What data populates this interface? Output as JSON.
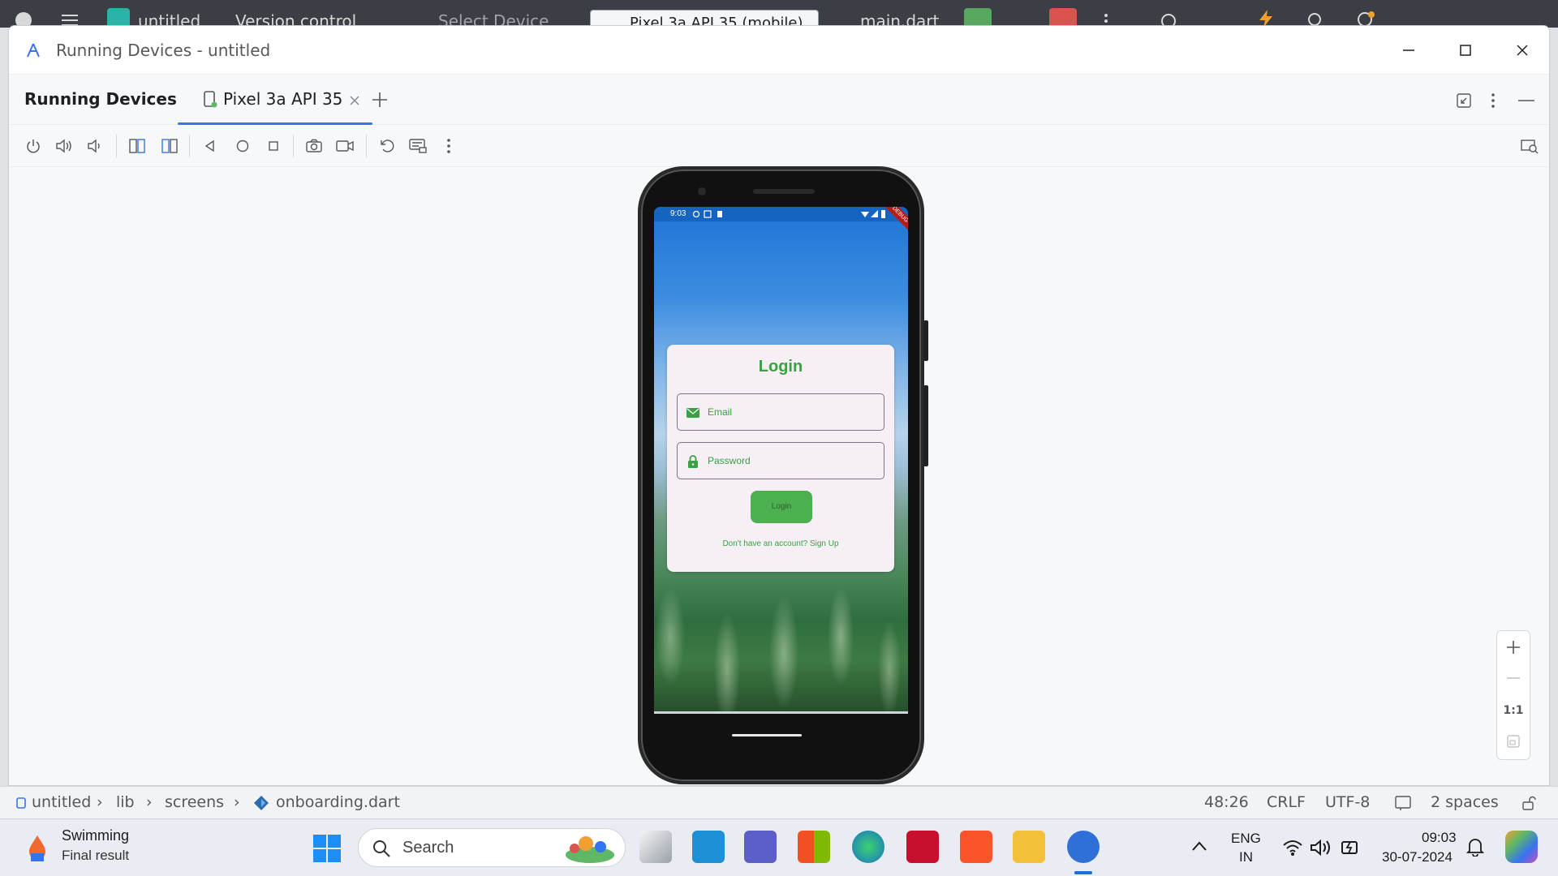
{
  "ide_top": {
    "project": "untitled",
    "vcs": "Version control",
    "select_device": "Select Device",
    "device_dropdown": "Pixel 3a API 35 (mobile)",
    "run_config": "main.dart"
  },
  "window": {
    "title": "Running Devices - untitled",
    "minimize_icon": "minimize-icon",
    "maximize_icon": "maximize-icon",
    "close_icon": "close-icon"
  },
  "tool_window": {
    "title": "Running Devices",
    "tab_label": "Pixel 3a API 35"
  },
  "toolbar": {
    "icons": [
      "power-icon",
      "volume-up-icon",
      "volume-down-icon",
      "rotate-left-icon",
      "rotate-right-icon",
      "back-icon",
      "home-icon",
      "overview-icon",
      "screenshot-icon",
      "screen-record-icon",
      "reset-icon",
      "keyboard-icon",
      "more-icon"
    ]
  },
  "phone": {
    "status_time": "9:03",
    "debug_banner": "DEBUG",
    "app": {
      "title": "Login",
      "email_label": "Email",
      "password_label": "Password",
      "login_button": "Login",
      "signup_text": "Don't have an account? Sign Up"
    },
    "colors": {
      "accent_green": "#3aa043",
      "button_green": "#4caf50"
    }
  },
  "zoom": {
    "zoom_in": "+",
    "zoom_out": "—",
    "actual_size": "1:1"
  },
  "statusbar": {
    "breadcrumb": [
      "untitled",
      "lib",
      "screens",
      "onboarding.dart"
    ],
    "position": "48:26",
    "line_sep": "CRLF",
    "encoding": "UTF-8",
    "indent": "2 spaces"
  },
  "taskbar": {
    "weather_title": "Swimming",
    "weather_sub": "Final result",
    "search": "Search",
    "lang_top": "ENG",
    "lang_bottom": "IN",
    "time": "09:03",
    "date": "30-07-2024"
  }
}
